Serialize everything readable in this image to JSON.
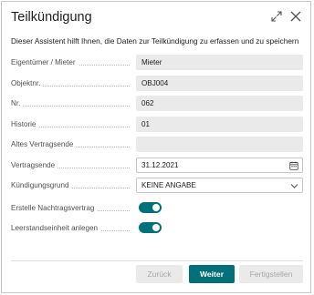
{
  "dialog": {
    "title": "Teilkündigung",
    "description": "Dieser Assistent hilft Ihnen, die Daten zur Teilkündigung zu erfassen und zu speichern"
  },
  "fields": [
    {
      "label": "Eigentümer / Mieter",
      "value": "Mieter"
    },
    {
      "label": "Objektnr.",
      "value": "OBJ004"
    },
    {
      "label": "Nr.",
      "value": "062"
    },
    {
      "label": "Historie",
      "value": "01"
    },
    {
      "label": "Altes Vertragsende",
      "value": ""
    },
    {
      "label": "Vertragsende",
      "value": "31.12.2021",
      "icon": "calendar-icon"
    },
    {
      "label": "Kündigungsgrund",
      "value": "KEINE ANGABE",
      "icon": "chevron-down-icon"
    }
  ],
  "toggles": [
    {
      "label": "Erstelle Nachtragsvertrag",
      "on": true
    },
    {
      "label": "Leerstandseinheit anlegen",
      "on": true
    }
  ],
  "buttons": {
    "back": "Zurück",
    "next": "Weiter",
    "finish": "Fertigstellen"
  },
  "colors": {
    "accent": "#00707a",
    "readonly_field": "#eaeaea",
    "disabled_text": "#a6a6a6"
  }
}
